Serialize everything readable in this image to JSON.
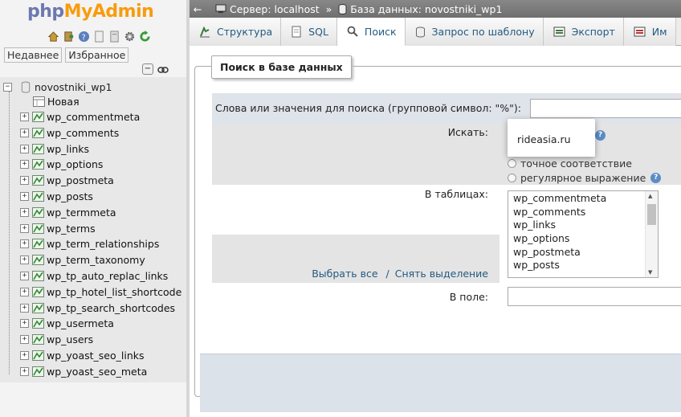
{
  "app": {
    "logo_php": "php",
    "logo_myadmin": "MyAdmin"
  },
  "nav": {
    "recent_label": "Недавнее",
    "favorites_label": "Избранное",
    "database": "novostniki_wp1",
    "new_label": "Новая",
    "tables": [
      "wp_commentmeta",
      "wp_comments",
      "wp_links",
      "wp_options",
      "wp_postmeta",
      "wp_posts",
      "wp_termmeta",
      "wp_terms",
      "wp_term_relationships",
      "wp_term_taxonomy",
      "wp_tp_auto_replac_links",
      "wp_tp_hotel_list_shortcode",
      "wp_tp_search_shortcodes",
      "wp_usermeta",
      "wp_users",
      "wp_yoast_seo_links",
      "wp_yoast_seo_meta"
    ]
  },
  "breadcrumb": {
    "server_label": "Сервер: localhost",
    "separator": "»",
    "db_label": "База данных: novostniki_wp1"
  },
  "tabs": [
    {
      "label": "Структура",
      "icon": "structure-icon",
      "active": false
    },
    {
      "label": "SQL",
      "icon": "sql-icon",
      "active": false
    },
    {
      "label": "Поиск",
      "icon": "search-icon",
      "active": true
    },
    {
      "label": "Запрос по шаблону",
      "icon": "query-icon",
      "active": false
    },
    {
      "label": "Экспорт",
      "icon": "export-icon",
      "active": false
    },
    {
      "label": "Им",
      "icon": "import-icon",
      "active": false
    }
  ],
  "search": {
    "legend": "Поиск в базе данных",
    "words_label": "Слова или значения для поиска (групповой символ: \"%\"):",
    "search_value": "",
    "find_label": "Искать:",
    "options": [
      "точное соответствие",
      "регулярное выражение"
    ],
    "in_tables_label": "В таблицах:",
    "tables_list": [
      "wp_commentmeta",
      "wp_comments",
      "wp_links",
      "wp_options",
      "wp_postmeta",
      "wp_posts"
    ],
    "select_all": "Выбрать все",
    "link_separator": "/",
    "unselect_all": "Снять выделение",
    "in_field_label": "В поле:",
    "field_value": ""
  },
  "autocomplete": {
    "suggestion": "rideasia.ru"
  },
  "colors": {
    "accent": "#235a81",
    "logo_blue": "#6c78af",
    "logo_orange": "#f89c0e"
  }
}
